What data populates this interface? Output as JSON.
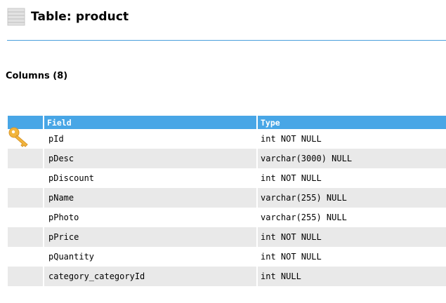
{
  "header": {
    "title": "Table: product",
    "icon": "table-icon"
  },
  "columns_section": {
    "title": "Columns (8)"
  },
  "columns_table": {
    "headers": {
      "key": "",
      "field": "Field",
      "type": "Type"
    },
    "rows": [
      {
        "field": "pId",
        "type": "int NOT NULL",
        "primary_key": true,
        "icon": "key-icon"
      },
      {
        "field": "pDesc",
        "type": "varchar(3000) NULL"
      },
      {
        "field": "pDiscount",
        "type": "int NOT NULL"
      },
      {
        "field": "pName",
        "type": "varchar(255) NULL"
      },
      {
        "field": "pPhoto",
        "type": "varchar(255) NULL"
      },
      {
        "field": "pPrice",
        "type": "int NOT NULL"
      },
      {
        "field": "pQuantity",
        "type": "int NOT NULL"
      },
      {
        "field": "category_categoryId",
        "type": "int NULL"
      }
    ]
  },
  "colors": {
    "accent": "#48a6e6",
    "divider": "#4a9fdc",
    "row_alt": "#e9e9e9",
    "key_icon": "#f0b43c"
  }
}
